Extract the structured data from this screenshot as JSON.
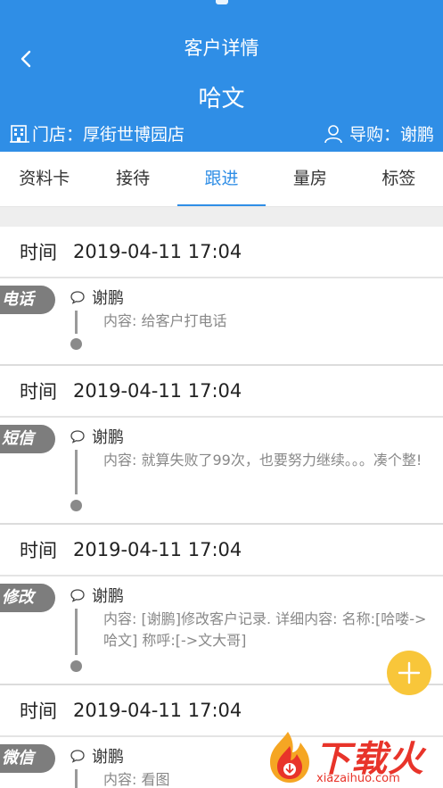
{
  "header": {
    "title": "客户详情",
    "customer_name": "哈文",
    "store": "门店：厚街世博园店",
    "guide": "导购：谢鹏",
    "bg_color": "#2f8ee6"
  },
  "tabs": [
    {
      "label": "资料卡",
      "active": false
    },
    {
      "label": "接待",
      "active": false
    },
    {
      "label": "跟进",
      "active": true
    },
    {
      "label": "量房",
      "active": false
    },
    {
      "label": "标签",
      "active": false
    }
  ],
  "records": [
    {
      "time_label": "时间",
      "time": "2019-04-11 17:04",
      "type": "电话",
      "author": "谢鹏",
      "content": "内容: 给客户打电话"
    },
    {
      "time_label": "时间",
      "time": "2019-04-11 17:04",
      "type": "短信",
      "author": "谢鹏",
      "content": "内容: 就算失败了99次，也要努力继续。。。凑个整!"
    },
    {
      "time_label": "时间",
      "time": "2019-04-11 17:04",
      "type": "修改",
      "author": "谢鹏",
      "content": "内容: [谢鹏]修改客户记录. 详细内容: 名称:[哈喽->哈文] 称呼:[->文大哥]"
    },
    {
      "time_label": "时间",
      "time": "2019-04-11 17:04",
      "type": "微信",
      "author": "谢鹏",
      "content": "内容: 看图"
    }
  ],
  "fab": {
    "icon": "plus-icon",
    "color": "#f8c63a"
  },
  "watermark": {
    "text": "下载火",
    "url": "xiazaihuo.com",
    "color": "#e8342a"
  }
}
